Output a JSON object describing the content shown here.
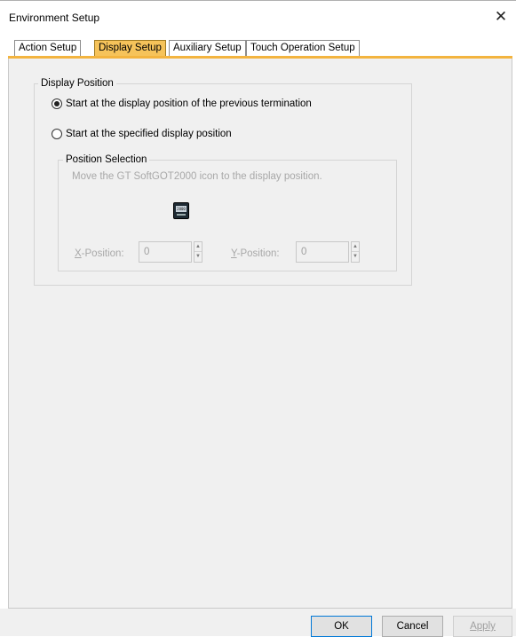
{
  "window": {
    "title": "Environment Setup",
    "close_glyph": "✕"
  },
  "tabs": [
    {
      "label": "Action Setup",
      "active": false
    },
    {
      "label": "Display Setup",
      "active": true
    },
    {
      "label": "Auxiliary Setup",
      "active": false
    },
    {
      "label": "Touch Operation Setup",
      "active": false
    }
  ],
  "display_position": {
    "group_label": "Display Position",
    "options": [
      {
        "label": "Start at the display position of the previous termination",
        "selected": true
      },
      {
        "label": "Start at the specified display position",
        "selected": false
      }
    ]
  },
  "position_selection": {
    "group_label": "Position Selection",
    "hint": "Move the GT SoftGOT2000 icon to the display position.",
    "icon_text": "2000",
    "x_label_key": "X",
    "x_label_rest": "-Position:",
    "x_value": "0",
    "y_label_key": "Y",
    "y_label_rest": "-Position:",
    "y_value": "0"
  },
  "footer": {
    "ok_label": "OK",
    "cancel_label": "Cancel",
    "apply_label": "Apply"
  },
  "colors": {
    "active_tab": "#f6c35a",
    "tab_underline": "#f3b43f",
    "panel_bg": "#f0f0f0"
  }
}
